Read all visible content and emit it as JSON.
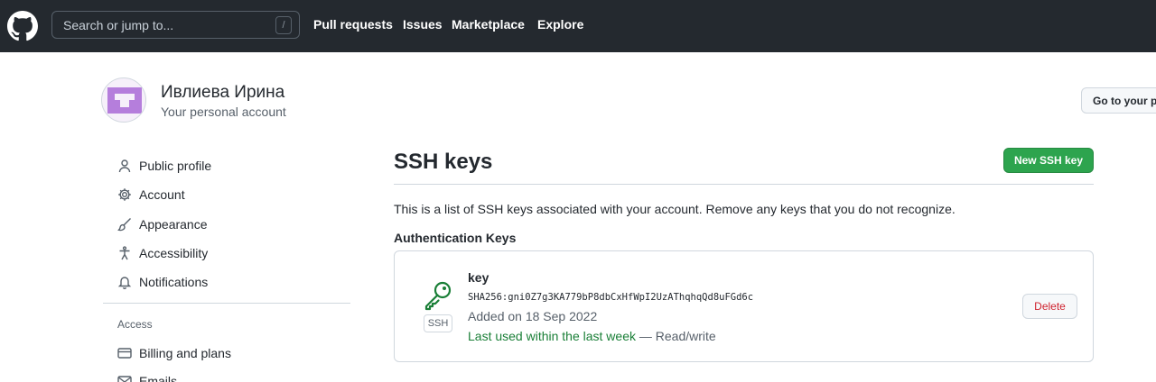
{
  "header": {
    "search_placeholder": "Search or jump to...",
    "search_shortcut": "/",
    "nav": [
      "Pull requests",
      "Issues",
      "Marketplace",
      "Explore"
    ]
  },
  "account": {
    "name": "Ивлиева Ирина",
    "subtitle": "Your personal account",
    "goto_button": "Go to your p"
  },
  "sidebar": {
    "items": [
      {
        "label": "Public profile",
        "icon": "person-icon"
      },
      {
        "label": "Account",
        "icon": "gear-icon"
      },
      {
        "label": "Appearance",
        "icon": "paintbrush-icon"
      },
      {
        "label": "Accessibility",
        "icon": "accessibility-icon"
      },
      {
        "label": "Notifications",
        "icon": "bell-icon"
      }
    ],
    "access_heading": "Access",
    "access_items": [
      {
        "label": "Billing and plans",
        "icon": "credit-card-icon"
      },
      {
        "label": "Emails",
        "icon": "mail-icon"
      }
    ]
  },
  "main": {
    "title": "SSH keys",
    "new_button": "New SSH key",
    "description": "This is a list of SSH keys associated with your account. Remove any keys that you do not recognize.",
    "section_heading": "Authentication Keys",
    "keys": [
      {
        "title": "key",
        "badge": "SSH",
        "fingerprint": "SHA256:gni0Z7g3KA779bP8dbCxHfWpI2UzAThqhqQd8uFGd6c",
        "added": "Added on 18 Sep 2022",
        "last_used": "Last used within the last week",
        "access": " — Read/write",
        "delete_label": "Delete"
      }
    ]
  },
  "colors": {
    "header_bg": "#24292f",
    "primary_button": "#2da44e",
    "success_text": "#1a7f37",
    "danger_text": "#cf222e",
    "avatar_accent": "#b57edc"
  }
}
